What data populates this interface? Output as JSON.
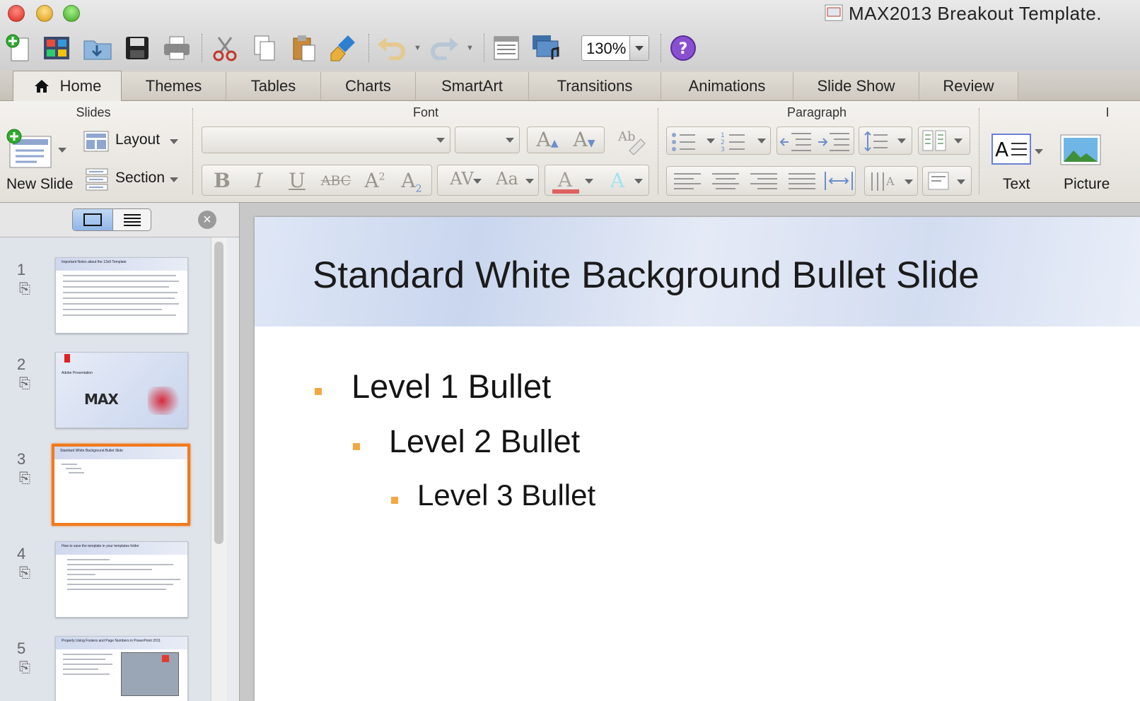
{
  "window": {
    "title": "MAX2013 Breakout Template."
  },
  "toolbar": {
    "zoom": "130%",
    "buttons": [
      "new-icon",
      "gallery-icon",
      "open-icon",
      "save-icon",
      "print-icon",
      "cut-icon",
      "copy-icon",
      "paste-icon",
      "format-brush-icon",
      "undo-icon",
      "redo-icon",
      "slide-sorter-icon",
      "media-icon",
      "help-icon"
    ]
  },
  "ribbon": {
    "tabs": [
      {
        "label": "Home",
        "active": true
      },
      {
        "label": "Themes"
      },
      {
        "label": "Tables"
      },
      {
        "label": "Charts"
      },
      {
        "label": "SmartArt"
      },
      {
        "label": "Transitions"
      },
      {
        "label": "Animations"
      },
      {
        "label": "Slide Show"
      },
      {
        "label": "Review"
      }
    ],
    "groups": {
      "slides": "Slides",
      "font": "Font",
      "paragraph": "Paragraph",
      "insert": "I"
    },
    "slides": {
      "new_slide": "New Slide",
      "layout": "Layout",
      "section": "Section"
    },
    "insert": {
      "text": "Text",
      "picture": "Picture"
    },
    "font": {
      "bold": "B",
      "italic": "I",
      "underline": "U",
      "strike": "ABC",
      "superscript": "A",
      "subscript": "A"
    }
  },
  "slide_pane": {
    "slides": [
      {
        "number": "1",
        "title": "Important Notes about the 13x9 Template"
      },
      {
        "number": "2",
        "title": "Adobe Presentation"
      },
      {
        "number": "3",
        "title": "Standard White Background Bullet Slide",
        "selected": true
      },
      {
        "number": "4",
        "title": "How to save the template in your templates folder"
      },
      {
        "number": "5",
        "title": "Properly Using Footers and Page Numbers in PowerPoint 2011"
      }
    ]
  },
  "slide": {
    "title": "Standard White Background Bullet Slide",
    "bullets": [
      {
        "level": 1,
        "text": "Level 1 Bullet"
      },
      {
        "level": 2,
        "text": "Level 2 Bullet"
      },
      {
        "level": 3,
        "text": "Level 3 Bullet"
      }
    ],
    "bullet_color": "#f4a742"
  }
}
